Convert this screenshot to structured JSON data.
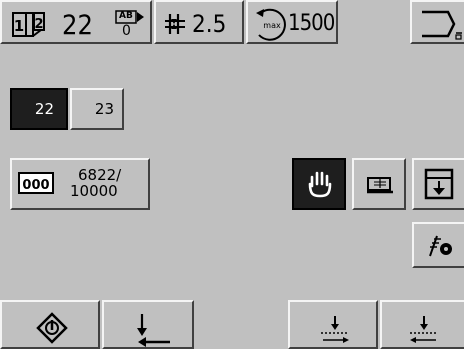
{
  "top_bar": {
    "seq_label_1": "1",
    "seq_label_2": "2",
    "pieces_value": "22",
    "ab_top": "AB",
    "ab_bottom": "0",
    "stitch_length": "2.5",
    "max_label": "max",
    "max_speed": "1500"
  },
  "program_tabs": [
    {
      "label": "22",
      "selected": true
    },
    {
      "label": "23",
      "selected": false
    }
  ],
  "counter": {
    "icon_text": "000",
    "current": "6822/",
    "total": "10000"
  },
  "colors": {
    "panel_bg": "#c0c0c0",
    "selected_bg": "#1e1e1e",
    "selected_text": "#ffffff"
  },
  "icons": {
    "exit": "exit-arrow-icon",
    "hand_stop": "hand-stop-icon",
    "presser_foot": "presser-foot-icon",
    "save_download": "save-down-arrow-icon",
    "thread_tension": "thread-tension-icon",
    "start_diamond": "start-diamond-icon",
    "reverse_stitch": "reverse-stitch-icon",
    "needle_position_right": "needle-right-icon",
    "needle_position_left": "needle-left-icon"
  }
}
